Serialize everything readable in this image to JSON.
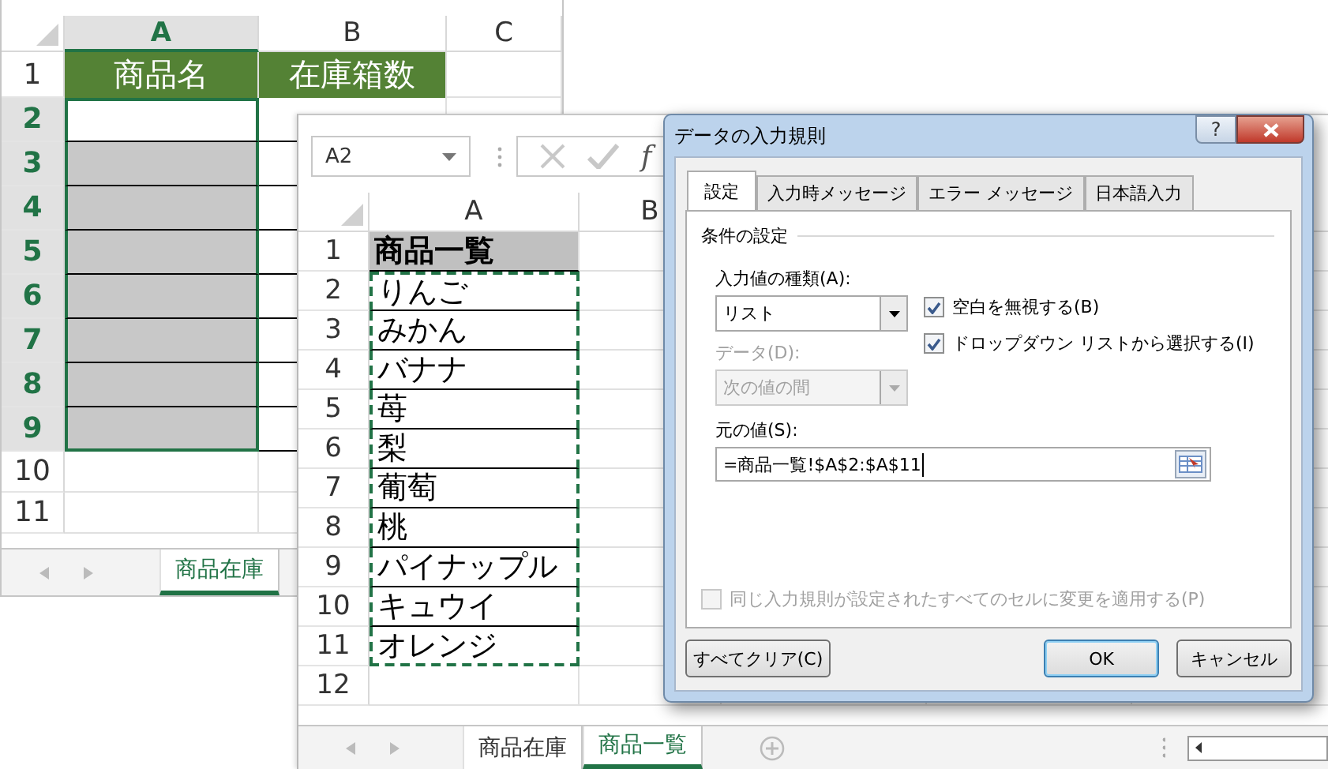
{
  "back_sheet": {
    "columns": [
      {
        "label": "A",
        "selected": true
      },
      {
        "label": "B",
        "selected": false
      },
      {
        "label": "C",
        "selected": false
      }
    ],
    "rows": [
      {
        "number": "1",
        "kind": "header",
        "selected": false,
        "table": true,
        "shaded": false,
        "cells": [
          "商品名",
          "在庫箱数"
        ]
      },
      {
        "number": "2",
        "kind": "data",
        "selected": true,
        "table": true,
        "shaded": false
      },
      {
        "number": "3",
        "kind": "data",
        "selected": true,
        "table": true,
        "shaded": true
      },
      {
        "number": "4",
        "kind": "data",
        "selected": true,
        "table": true,
        "shaded": true
      },
      {
        "number": "5",
        "kind": "data",
        "selected": true,
        "table": true,
        "shaded": true
      },
      {
        "number": "6",
        "kind": "data",
        "selected": true,
        "table": true,
        "shaded": true
      },
      {
        "number": "7",
        "kind": "data",
        "selected": true,
        "table": true,
        "shaded": true
      },
      {
        "number": "8",
        "kind": "data",
        "selected": true,
        "table": true,
        "shaded": true
      },
      {
        "number": "9",
        "kind": "data",
        "selected": true,
        "table": true,
        "shaded": true
      },
      {
        "number": "10",
        "kind": "data",
        "selected": false,
        "table": false,
        "shaded": false
      },
      {
        "number": "11",
        "kind": "data",
        "selected": false,
        "table": false,
        "shaded": false
      }
    ],
    "tabs": [
      {
        "label": "商品在庫",
        "selected": true
      }
    ]
  },
  "middle_sheet": {
    "name_box": "A2",
    "formula_icon": "f",
    "columns": [
      {
        "label": "A"
      },
      {
        "label": "B"
      }
    ],
    "rows": [
      {
        "number": "1",
        "kind": "header",
        "value": "商品一覧"
      },
      {
        "number": "2",
        "kind": "item",
        "value": "りんご"
      },
      {
        "number": "3",
        "kind": "item",
        "value": "みかん"
      },
      {
        "number": "4",
        "kind": "item",
        "value": "バナナ"
      },
      {
        "number": "5",
        "kind": "item",
        "value": "苺"
      },
      {
        "number": "6",
        "kind": "item",
        "value": "梨"
      },
      {
        "number": "7",
        "kind": "item",
        "value": "葡萄"
      },
      {
        "number": "8",
        "kind": "item",
        "value": "桃"
      },
      {
        "number": "9",
        "kind": "item",
        "value": "パイナップル"
      },
      {
        "number": "10",
        "kind": "item",
        "value": "キュウイ"
      },
      {
        "number": "11",
        "kind": "item",
        "value": "オレンジ"
      },
      {
        "number": "12",
        "kind": "empty"
      }
    ],
    "tabs": [
      {
        "label": "商品在庫",
        "selected": false
      },
      {
        "label": "商品一覧",
        "selected": true
      }
    ]
  },
  "dialog": {
    "title": "データの入力規則",
    "help_button": "?",
    "tabs": [
      {
        "label": "設定",
        "selected": true
      },
      {
        "label": "入力時メッセージ",
        "selected": false
      },
      {
        "label": "エラー メッセージ",
        "selected": false
      },
      {
        "label": "日本語入力",
        "selected": false
      }
    ],
    "section": "条件の設定",
    "allow": {
      "label": "入力値の種類(A):",
      "value": "リスト"
    },
    "options": [
      {
        "label": "空白を無視する(B)",
        "checked": true
      },
      {
        "label": "ドロップダウン リストから選択する(I)",
        "checked": true
      }
    ],
    "data": {
      "label": "データ(D):",
      "value": "次の値の間",
      "disabled": true
    },
    "source": {
      "label": "元の値(S):",
      "value": "=商品一覧!$A$2:$A$11"
    },
    "apply_all": {
      "label": "同じ入力規則が設定されたすべてのセルに変更を適用する(P)",
      "checked": false,
      "disabled": true
    },
    "buttons": [
      {
        "label": "すべてクリア(C)",
        "default": false
      },
      {
        "label": "OK",
        "default": true
      },
      {
        "label": "キャンセル",
        "default": false
      }
    ]
  }
}
